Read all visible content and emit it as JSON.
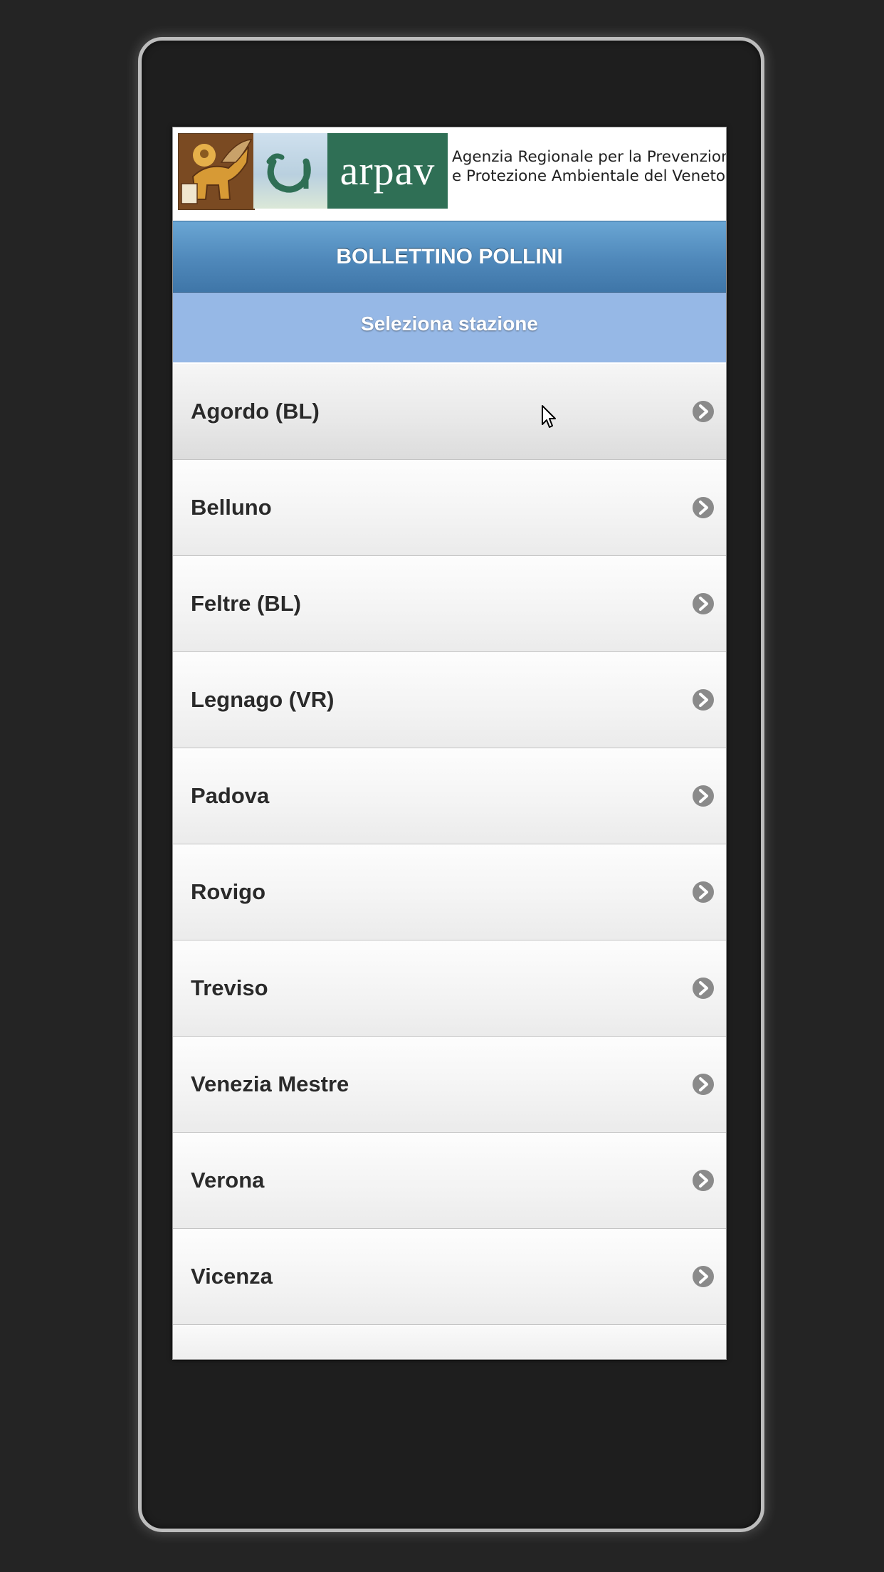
{
  "header": {
    "logo_text": "arpav",
    "agency_line1": "Agenzia Regionale per la Prevenzione",
    "agency_line2": "e Protezione Ambientale del Veneto"
  },
  "title": "BOLLETTINO POLLINI",
  "subtitle": "Seleziona stazione",
  "stations": [
    {
      "label": "Agordo (BL)",
      "icon": "chevron-right-icon"
    },
    {
      "label": "Belluno",
      "icon": "chevron-right-icon"
    },
    {
      "label": "Feltre (BL)",
      "icon": "chevron-right-icon"
    },
    {
      "label": "Legnago (VR)",
      "icon": "chevron-right-icon"
    },
    {
      "label": "Padova",
      "icon": "chevron-right-icon"
    },
    {
      "label": "Rovigo",
      "icon": "chevron-right-icon"
    },
    {
      "label": "Treviso",
      "icon": "chevron-right-icon"
    },
    {
      "label": "Venezia Mestre",
      "icon": "chevron-right-icon"
    },
    {
      "label": "Verona",
      "icon": "chevron-right-icon"
    },
    {
      "label": "Vicenza",
      "icon": "chevron-right-icon"
    }
  ],
  "colors": {
    "title_bar": "#4f88ba",
    "sub_bar": "#96b8e6",
    "logo_green": "#2f6f55",
    "chevron": "#8a8a8a"
  }
}
